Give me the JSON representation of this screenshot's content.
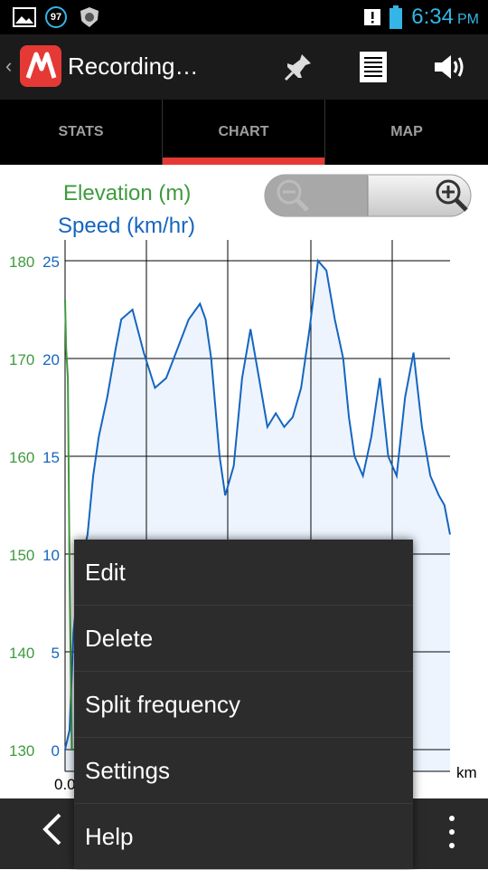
{
  "status_bar": {
    "notification_count": "97",
    "time": "6:34",
    "am_pm": "PM",
    "icons": [
      "gallery-icon",
      "notification-badge-icon",
      "security-icon",
      "alert-icon",
      "battery-icon"
    ]
  },
  "action_bar": {
    "title": "Recording…",
    "icons": [
      "pin-icon",
      "list-icon",
      "volume-icon"
    ]
  },
  "tabs": [
    {
      "label": "STATS"
    },
    {
      "label": "CHART",
      "active": true
    },
    {
      "label": "MAP"
    }
  ],
  "chart": {
    "legend_elevation": "Elevation (m)",
    "legend_speed": "Speed (km/hr)",
    "elevation_ticks": [
      "180",
      "170",
      "160",
      "150",
      "140",
      "130"
    ],
    "speed_ticks": [
      "25",
      "20",
      "15",
      "10",
      "5",
      "0"
    ],
    "x_start_label": "0.0",
    "x_unit": "km",
    "colors": {
      "elevation": "#3f9a3f",
      "speed": "#1565c0"
    }
  },
  "chart_data": {
    "type": "area",
    "title": "",
    "xlabel": "km",
    "series": [
      {
        "name": "Elevation (m)",
        "y_axis": "left-outer",
        "ylim": [
          130,
          180
        ],
        "points": [
          [
            0,
            176
          ],
          [
            0.02,
            171
          ],
          [
            0.05,
            168
          ],
          [
            0.08,
            148
          ],
          [
            0.12,
            130
          ],
          [
            0.2,
            130
          ],
          [
            0.5,
            130
          ],
          [
            1,
            130
          ],
          [
            2,
            130
          ],
          [
            3,
            130
          ],
          [
            3.6,
            141.5
          ],
          [
            3.8,
            141
          ],
          [
            3.95,
            139
          ],
          [
            4.05,
            134
          ]
        ]
      },
      {
        "name": "Speed (km/hr)",
        "y_axis": "left-inner",
        "ylim": [
          0,
          25
        ],
        "points": [
          [
            0,
            0
          ],
          [
            0.08,
            1
          ],
          [
            0.15,
            6
          ],
          [
            0.25,
            9
          ],
          [
            0.4,
            11
          ],
          [
            0.5,
            14
          ],
          [
            0.6,
            16
          ],
          [
            0.75,
            18
          ],
          [
            0.9,
            20.5
          ],
          [
            1.0,
            22
          ],
          [
            1.2,
            22.5
          ],
          [
            1.4,
            20.3
          ],
          [
            1.6,
            18.5
          ],
          [
            1.8,
            19
          ],
          [
            2.0,
            20.5
          ],
          [
            2.2,
            22
          ],
          [
            2.4,
            22.8
          ],
          [
            2.5,
            22
          ],
          [
            2.6,
            20
          ],
          [
            2.75,
            15
          ],
          [
            2.85,
            13
          ],
          [
            3.0,
            14.5
          ],
          [
            3.15,
            19
          ],
          [
            3.3,
            21.5
          ],
          [
            3.45,
            19
          ],
          [
            3.6,
            16.5
          ],
          [
            3.75,
            17.2
          ],
          [
            3.9,
            16.5
          ],
          [
            4.05,
            17
          ],
          [
            4.2,
            18.5
          ],
          [
            4.35,
            21.5
          ],
          [
            4.5,
            25
          ],
          [
            4.65,
            24.5
          ],
          [
            4.8,
            22
          ],
          [
            4.95,
            20
          ],
          [
            5.05,
            17
          ],
          [
            5.15,
            15
          ],
          [
            5.3,
            14
          ],
          [
            5.45,
            16
          ],
          [
            5.6,
            19
          ],
          [
            5.75,
            15
          ],
          [
            5.9,
            14
          ],
          [
            6.05,
            18
          ],
          [
            6.2,
            20.3
          ],
          [
            6.35,
            16.5
          ],
          [
            6.5,
            14
          ],
          [
            6.65,
            13
          ],
          [
            6.75,
            12.5
          ],
          [
            6.85,
            11
          ]
        ]
      }
    ]
  },
  "zoom": {
    "icons": [
      "zoom-out-icon",
      "zoom-in-icon"
    ]
  },
  "menu": {
    "items": [
      "Edit",
      "Delete",
      "Split frequency",
      "Settings",
      "Help"
    ]
  },
  "nav": {
    "icons": [
      "back-arrow-icon",
      "overflow-menu-icon"
    ]
  }
}
